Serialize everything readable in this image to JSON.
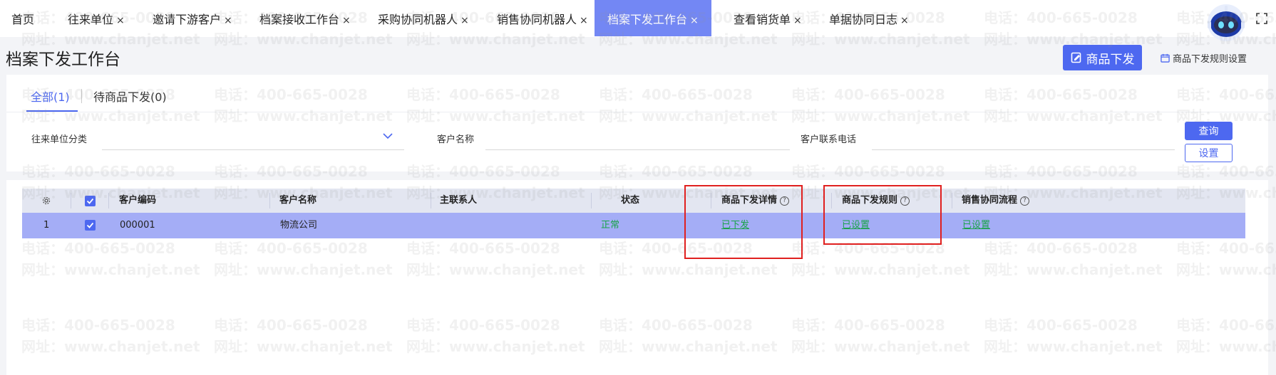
{
  "tabs": [
    {
      "label": "首页",
      "closable": false
    },
    {
      "label": "往来单位",
      "closable": true
    },
    {
      "label": "邀请下游客户",
      "closable": true
    },
    {
      "label": "档案接收工作台",
      "closable": true
    },
    {
      "label": "采购协同机器人",
      "closable": true
    },
    {
      "label": "销售协同机器人",
      "closable": true
    },
    {
      "label": "档案下发工作台",
      "closable": true,
      "active": true
    },
    {
      "label": "查看销货单",
      "closable": true
    },
    {
      "label": "单据协同日志",
      "closable": true
    }
  ],
  "close_glyph": "×",
  "header": {
    "title": "档案下发工作台",
    "primary_button": "商品下发",
    "settings_link": "商品下发规则设置"
  },
  "subtabs": {
    "all": "全部(1)",
    "pending": "待商品下发(0)"
  },
  "filters": {
    "category_label": "往来单位分类",
    "customer_name_label": "客户名称",
    "phone_label": "客户联系电话",
    "query_button": "查询",
    "settings_button": "设置"
  },
  "table": {
    "columns": {
      "code": "客户编码",
      "name": "客户名称",
      "contact": "主联系人",
      "status": "状态",
      "detail": "商品下发详情",
      "rule": "商品下发规则",
      "flow": "销售协同流程"
    },
    "rows": [
      {
        "index": "1",
        "code": "000001",
        "name": "物流公司",
        "contact": "",
        "status": "正常",
        "detail": "已下发",
        "rule": "已设置",
        "flow": "已设置",
        "checked": true
      }
    ]
  },
  "watermark": {
    "phone": "电话：400-665-0028",
    "site": "网址：www.chanjet.net"
  },
  "colors": {
    "accent": "#4d68f0",
    "active_tab": "#7387f4",
    "selected_row": "#a4adf6",
    "status_green": "#1aa34a",
    "highlight_box": "#e0201f"
  },
  "icons": {
    "tab_close": "close-icon",
    "robot": "assistant-robot-icon",
    "fullscreen": "fullscreen-icon",
    "edit": "edit-icon",
    "calendar": "calendar-icon",
    "chevron": "chevron-down-icon",
    "gear": "gear-icon",
    "help": "help-icon"
  }
}
